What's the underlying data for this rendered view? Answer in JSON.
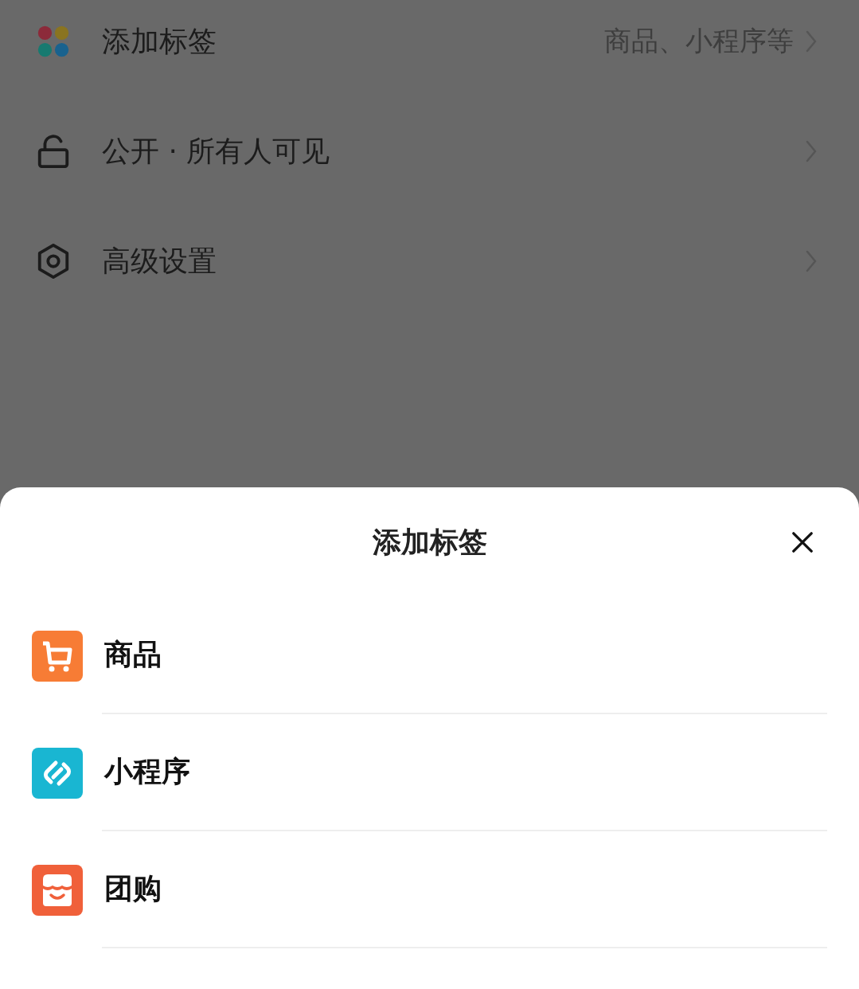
{
  "settings": [
    {
      "kind": "tags",
      "label": "添加标签",
      "value": "商品、小程序等"
    },
    {
      "kind": "lock",
      "label": "公开 · 所有人可见"
    },
    {
      "kind": "settings",
      "label": "高级设置"
    }
  ],
  "sheet": {
    "title": "添加标签",
    "options": [
      {
        "kind": "cart",
        "label": "商品"
      },
      {
        "kind": "link",
        "label": "小程序"
      },
      {
        "kind": "store",
        "label": "团购"
      }
    ]
  }
}
